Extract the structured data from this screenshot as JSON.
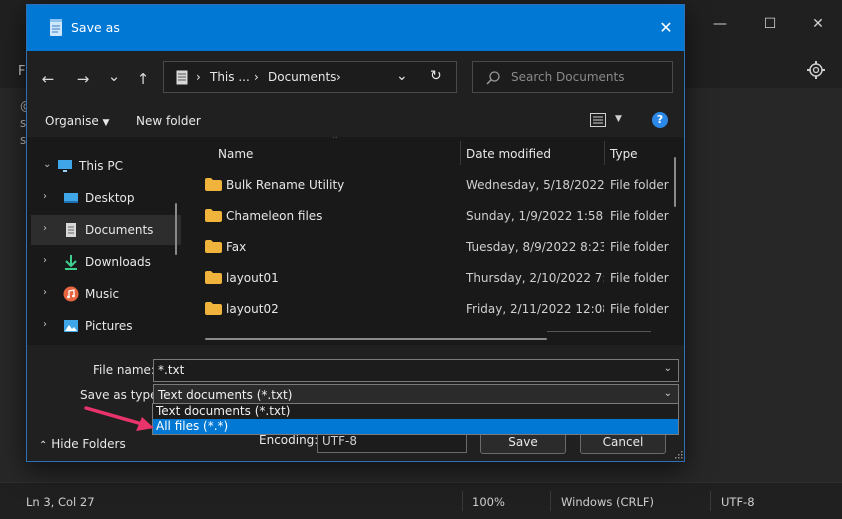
{
  "dialog": {
    "title": "Save as",
    "close_glyph": "✕"
  },
  "nav": {
    "back": "←",
    "forward": "→",
    "recent": "⌄",
    "up": "↑",
    "address": {
      "segments": [
        "This ...",
        "Documents"
      ],
      "separator": "›"
    },
    "search_placeholder": "Search Documents"
  },
  "commands": {
    "organise": "Organise",
    "new_folder": "New folder"
  },
  "sidebar": {
    "items": [
      {
        "label": "This PC",
        "icon": "computer-icon",
        "expanded": true
      },
      {
        "label": "Desktop",
        "icon": "desktop-icon"
      },
      {
        "label": "Documents",
        "icon": "documents-icon",
        "selected": true
      },
      {
        "label": "Downloads",
        "icon": "downloads-icon"
      },
      {
        "label": "Music",
        "icon": "music-icon"
      },
      {
        "label": "Pictures",
        "icon": "pictures-icon"
      }
    ]
  },
  "filelist": {
    "columns": {
      "name": "Name",
      "date": "Date modified",
      "type": "Type"
    },
    "rows": [
      {
        "name": "Bulk Rename Utility",
        "date": "Wednesday, 5/18/2022 ...",
        "type": "File folder"
      },
      {
        "name": "Chameleon files",
        "date": "Sunday, 1/9/2022 1:58 ...",
        "type": "File folder"
      },
      {
        "name": "Fax",
        "date": "Tuesday, 8/9/2022 8:23...",
        "type": "File folder"
      },
      {
        "name": "layout01",
        "date": "Thursday, 2/10/2022 7:...",
        "type": "File folder"
      },
      {
        "name": "layout02",
        "date": "Friday, 2/11/2022 12:08...",
        "type": "File folder"
      }
    ]
  },
  "footer": {
    "file_name_label": "File name:",
    "file_name_value": "*.txt",
    "save_type_label": "Save as type:",
    "save_type_value": "Text documents (*.txt)",
    "hide_folders": "Hide Folders",
    "encoding_label": "Encoding:",
    "encoding_value": "UTF-8",
    "save_button": "Save",
    "cancel_button": "Cancel"
  },
  "dropdown": {
    "options": [
      "Text documents (*.txt)",
      "All files  (*.*)"
    ],
    "selected_index": 1
  },
  "notepad": {
    "menu_letter": "F",
    "body_lines": [
      "@",
      "s",
      "s"
    ],
    "status": {
      "position": "Ln 3, Col 27",
      "zoom": "100%",
      "line_ending": "Windows (CRLF)",
      "encoding": "UTF-8"
    }
  },
  "colors": {
    "accent": "#0078d4",
    "arrow": "#e8336b",
    "folder": "#f0b43c"
  }
}
